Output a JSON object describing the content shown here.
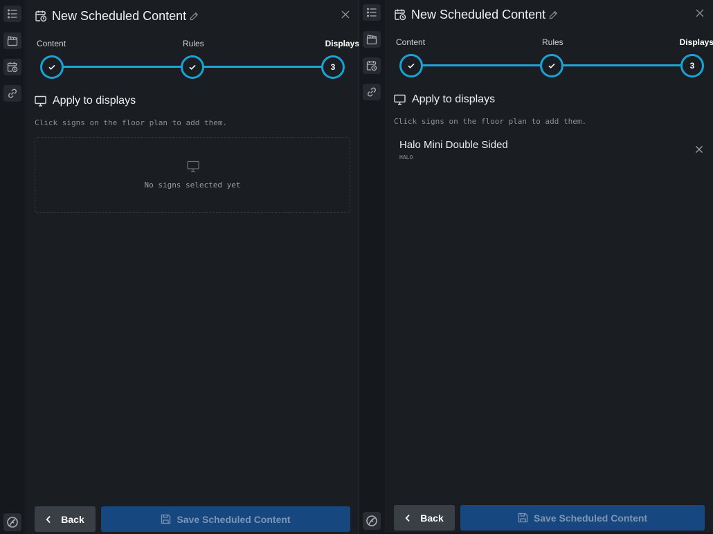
{
  "colors": {
    "accent": "#18a3d4",
    "save_button": "#17477f",
    "back_button": "#3a3f46"
  },
  "rail": {
    "icons": [
      "list-icon",
      "clapperboard-icon",
      "calendar-clock-icon",
      "link-icon"
    ],
    "logo": "app-logo-icon"
  },
  "left": {
    "title": "New Scheduled Content",
    "steps": [
      {
        "label": "Content",
        "state": "done"
      },
      {
        "label": "Rules",
        "state": "done"
      },
      {
        "label": "Displays",
        "state": "current",
        "number": "3"
      }
    ],
    "section_title": "Apply to displays",
    "hint": "Click signs on the floor plan to add them.",
    "empty_text": "No signs selected yet",
    "back_label": "Back",
    "save_label": "Save Scheduled Content"
  },
  "right": {
    "title": "New Scheduled Content",
    "steps": [
      {
        "label": "Content",
        "state": "done"
      },
      {
        "label": "Rules",
        "state": "done"
      },
      {
        "label": "Displays",
        "state": "current",
        "number": "3"
      }
    ],
    "section_title": "Apply to displays",
    "hint": "Click signs on the floor plan to add them.",
    "displays": [
      {
        "name": "Halo Mini Double Sided",
        "type": "HALO"
      }
    ],
    "back_label": "Back",
    "save_label": "Save Scheduled Content"
  }
}
